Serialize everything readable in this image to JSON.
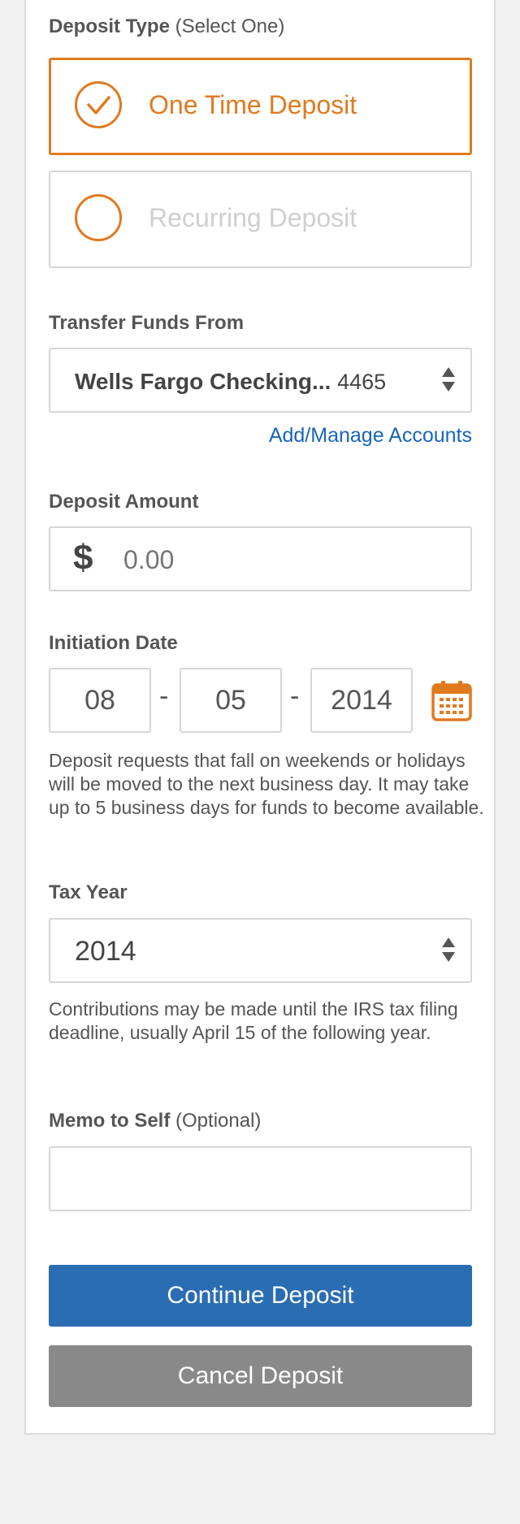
{
  "deposit_type": {
    "label_bold": "Deposit Type",
    "label_hint": "(Select One)",
    "options": [
      {
        "label": "One Time Deposit",
        "selected": true
      },
      {
        "label": "Recurring Deposit",
        "selected": false
      }
    ]
  },
  "transfer_from": {
    "label": "Transfer Funds From",
    "account_name": "Wells Fargo Checking...",
    "account_suffix": "4465",
    "manage_link": "Add/Manage Accounts"
  },
  "deposit_amount": {
    "label": "Deposit Amount",
    "currency_symbol": "$",
    "placeholder": "0.00",
    "value": ""
  },
  "initiation_date": {
    "label": "Initiation Date",
    "month": "08",
    "day": "05",
    "year": "2014",
    "separator": "-",
    "help_text": "Deposit requests that fall on weekends or holidays will be moved to the next business day. It may take up to 5 business days for funds to become available."
  },
  "tax_year": {
    "label": "Tax Year",
    "value": "2014",
    "help_text": "Contributions may be made until the IRS tax filing deadline, usually April 15 of the following year."
  },
  "memo": {
    "label_bold": "Memo to Self",
    "label_hint": "(Optional)",
    "value": ""
  },
  "actions": {
    "continue": "Continue Deposit",
    "cancel": "Cancel Deposit"
  },
  "colors": {
    "accent_orange": "#e07a1f",
    "primary_blue": "#2a6db2",
    "link_blue": "#1866b8",
    "secondary_gray": "#898989",
    "page_bg": "#f1f1f1"
  },
  "icons": {
    "selected_radio": "check-circle-icon",
    "unselected_radio": "radio-empty-icon",
    "calendar": "calendar-icon",
    "select_arrows": "select-arrows-icon"
  }
}
